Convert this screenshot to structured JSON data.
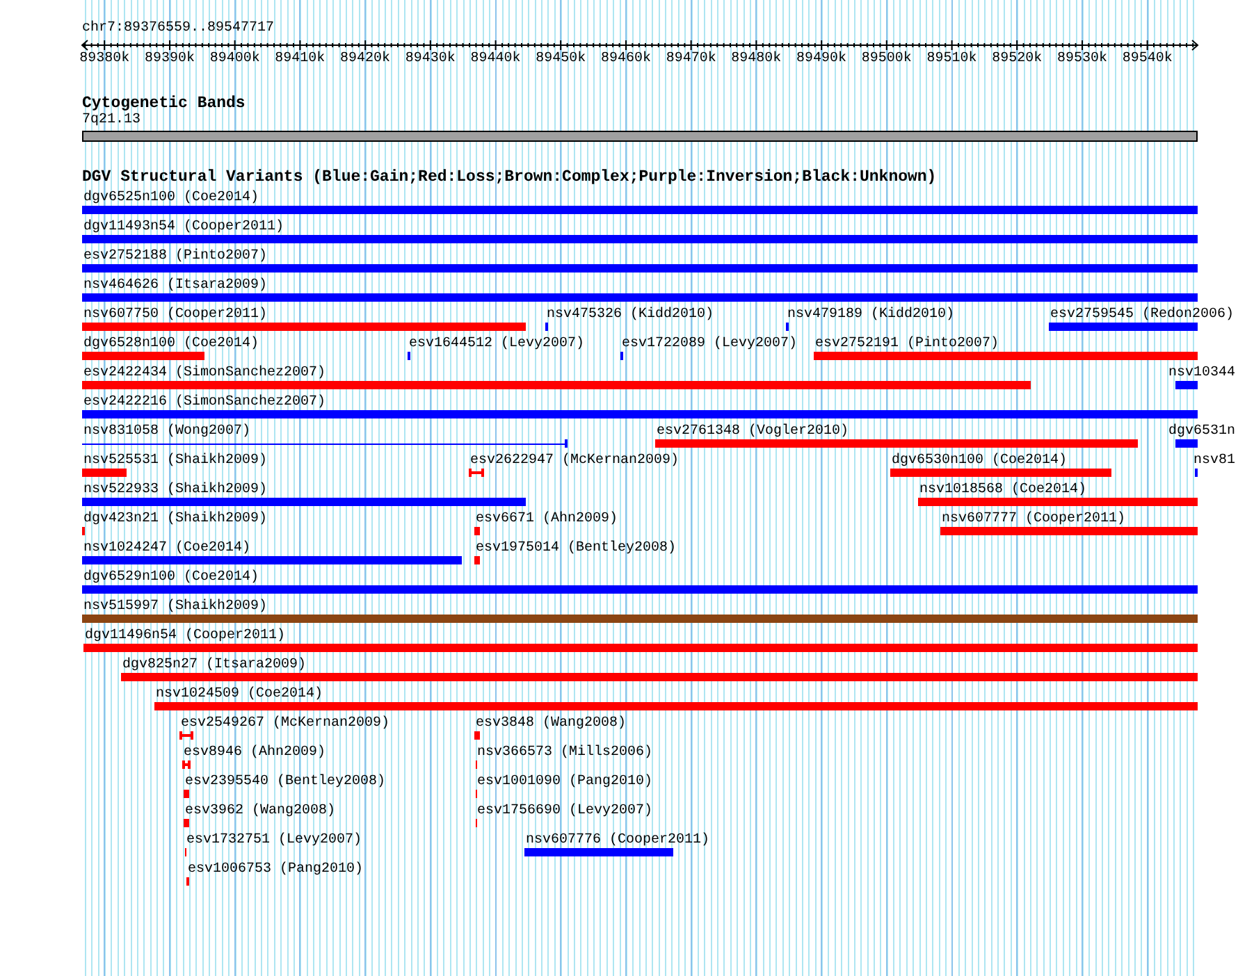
{
  "ruler": {
    "location": "chr7:89376559..89547717",
    "ticks": [
      "89380k",
      "89390k",
      "89400k",
      "89410k",
      "89420k",
      "89430k",
      "89440k",
      "89450k",
      "89460k",
      "89470k",
      "89480k",
      "89490k",
      "89500k",
      "89510k",
      "89520k",
      "89530k",
      "89540k"
    ]
  },
  "cytogenetic_track": {
    "title": "Cytogenetic Bands",
    "band": "7q21.13"
  },
  "variants_track": {
    "title": "DGV Structural Variants (Blue:Gain;Red:Loss;Brown:Complex;Purple:Inversion;Black:Unknown)",
    "lanes": [
      {
        "features": [
          {
            "label": "dgv6525n100 (Coe2014)",
            "color": "#0000ff",
            "kind": "bar"
          }
        ]
      },
      {
        "features": [
          {
            "label": "dgv11493n54 (Cooper2011)",
            "color": "#0000ff",
            "kind": "bar"
          }
        ]
      },
      {
        "features": [
          {
            "label": "esv2752188 (Pinto2007)",
            "color": "#0000ff",
            "kind": "bar"
          }
        ]
      },
      {
        "features": [
          {
            "label": "nsv464626 (Itsara2009)",
            "color": "#0000ff",
            "kind": "bar"
          }
        ]
      },
      {
        "features": [
          {
            "label": "nsv607750 (Cooper2011)",
            "color": "#ff0000",
            "kind": "bar"
          },
          {
            "label": "nsv475326 (Kidd2010)",
            "color": "#0000ff",
            "kind": "bar"
          },
          {
            "label": "nsv479189 (Kidd2010)",
            "color": "#0000ff",
            "kind": "bar"
          },
          {
            "label": "esv2759545 (Redon2006)",
            "color": "#0000ff",
            "kind": "bar"
          }
        ]
      },
      {
        "features": [
          {
            "label": "dgv6528n100 (Coe2014)",
            "color": "#ff0000",
            "kind": "bar"
          },
          {
            "label": "esv1644512 (Levy2007)",
            "color": "#0000ff",
            "kind": "bar"
          },
          {
            "label": "esv1722089 (Levy2007)",
            "color": "#0000ff",
            "kind": "bar"
          },
          {
            "label": "esv2752191 (Pinto2007)",
            "color": "#ff0000",
            "kind": "bar"
          }
        ]
      },
      {
        "features": [
          {
            "label": "esv2422434 (SimonSanchez2007)",
            "color": "#ff0000",
            "kind": "bar"
          },
          {
            "label": "nsv10344",
            "color": "#0000ff",
            "kind": "bar"
          }
        ]
      },
      {
        "features": [
          {
            "label": "esv2422216 (SimonSanchez2007)",
            "color": "#0000ff",
            "kind": "bar"
          }
        ]
      },
      {
        "features": [
          {
            "label": "nsv831058 (Wong2007)",
            "color": "#0000ff",
            "kind": "line"
          },
          {
            "label": "esv2761348 (Vogler2010)",
            "color": "#ff0000",
            "kind": "bar"
          },
          {
            "label": "dgv6531n",
            "color": "#0000ff",
            "kind": "bar"
          }
        ]
      },
      {
        "features": [
          {
            "label": "nsv525531 (Shaikh2009)",
            "color": "#ff0000",
            "kind": "bar"
          },
          {
            "label": "esv2622947 (McKernan2009)",
            "color": "#ff0000",
            "kind": "bracket"
          },
          {
            "label": "dgv6530n100 (Coe2014)",
            "color": "#ff0000",
            "kind": "bar"
          },
          {
            "label": "nsv81",
            "color": "#0000ff",
            "kind": "bar"
          }
        ]
      },
      {
        "features": [
          {
            "label": "nsv522933 (Shaikh2009)",
            "color": "#0000ff",
            "kind": "bar"
          },
          {
            "label": "nsv1018568 (Coe2014)",
            "color": "#ff0000",
            "kind": "bar"
          }
        ]
      },
      {
        "features": [
          {
            "label": "dgv423n21 (Shaikh2009)",
            "color": "#ff0000",
            "kind": "bar"
          },
          {
            "label": "esv6671 (Ahn2009)",
            "color": "#ff0000",
            "kind": "bar"
          },
          {
            "label": "nsv607777 (Cooper2011)",
            "color": "#ff0000",
            "kind": "bar"
          }
        ]
      },
      {
        "features": [
          {
            "label": "nsv1024247 (Coe2014)",
            "color": "#0000ff",
            "kind": "bar"
          },
          {
            "label": "esv1975014 (Bentley2008)",
            "color": "#ff0000",
            "kind": "bar"
          }
        ]
      },
      {
        "features": [
          {
            "label": "dgv6529n100 (Coe2014)",
            "color": "#0000ff",
            "kind": "bar"
          }
        ]
      },
      {
        "features": [
          {
            "label": "nsv515997 (Shaikh2009)",
            "color": "#8b4513",
            "kind": "bar"
          }
        ]
      },
      {
        "features": [
          {
            "label": "dgv11496n54 (Cooper2011)",
            "color": "#ff0000",
            "kind": "bar"
          }
        ]
      },
      {
        "features": [
          {
            "label": "dgv825n27 (Itsara2009)",
            "color": "#ff0000",
            "kind": "bar"
          }
        ]
      },
      {
        "features": [
          {
            "label": "nsv1024509 (Coe2014)",
            "color": "#ff0000",
            "kind": "bar"
          }
        ]
      },
      {
        "features": [
          {
            "label": "esv2549267 (McKernan2009)",
            "color": "#ff0000",
            "kind": "bracket"
          },
          {
            "label": "esv3848 (Wang2008)",
            "color": "#ff0000",
            "kind": "bracket"
          }
        ]
      },
      {
        "features": [
          {
            "label": "esv8946 (Ahn2009)",
            "color": "#ff0000",
            "kind": "bracket"
          },
          {
            "label": "nsv366573 (Mills2006)",
            "color": "#ff0000",
            "kind": "bar"
          }
        ]
      },
      {
        "features": [
          {
            "label": "esv2395540 (Bentley2008)",
            "color": "#ff0000",
            "kind": "bar"
          },
          {
            "label": "esv1001090 (Pang2010)",
            "color": "#ff0000",
            "kind": "bar"
          }
        ]
      },
      {
        "features": [
          {
            "label": "esv3962 (Wang2008)",
            "color": "#ff0000",
            "kind": "bracket"
          },
          {
            "label": "esv1756690 (Levy2007)",
            "color": "#ff0000",
            "kind": "bar"
          }
        ]
      },
      {
        "features": [
          {
            "label": "esv1732751 (Levy2007)",
            "color": "#ff0000",
            "kind": "bar"
          },
          {
            "label": "nsv607776 (Cooper2011)",
            "color": "#0000ff",
            "kind": "bar"
          }
        ]
      },
      {
        "features": [
          {
            "label": "esv1006753 (Pang2010)",
            "color": "#ff0000",
            "kind": "bar"
          }
        ]
      }
    ]
  }
}
